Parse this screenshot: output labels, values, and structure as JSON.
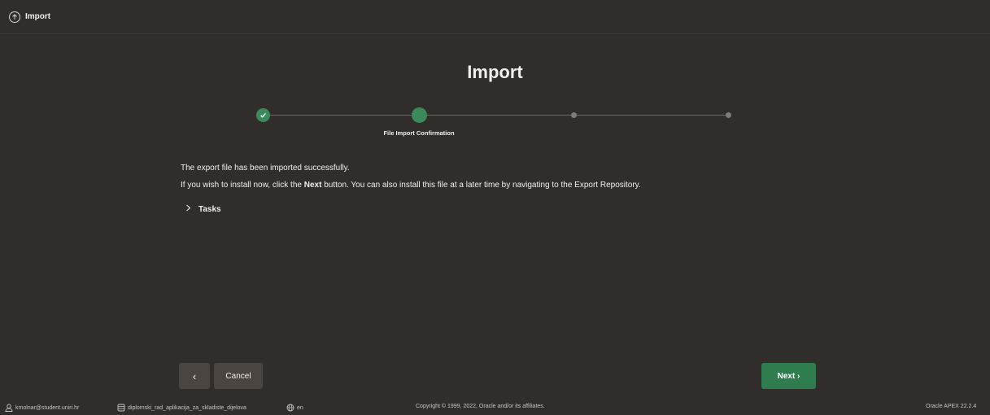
{
  "header": {
    "title": "Import",
    "icon": "upload-arrow-icon"
  },
  "page": {
    "title": "Import"
  },
  "wizard": {
    "steps": [
      {
        "label": "",
        "status": "complete"
      },
      {
        "label": "File Import Confirmation",
        "status": "current"
      },
      {
        "label": "",
        "status": "pending"
      },
      {
        "label": "",
        "status": "pending"
      }
    ]
  },
  "message": {
    "line1": "The export file has been imported successfully.",
    "line2_prefix": "If you wish to install now, click the ",
    "line2_bold": "Next",
    "line2_suffix": " button. You can also install this file at a later time by navigating to the Export Repository."
  },
  "tasks": {
    "label": "Tasks",
    "expanded": false
  },
  "buttons": {
    "back": "‹",
    "cancel": "Cancel",
    "next": "Next ›"
  },
  "footer": {
    "user": "kmolnar@student.uniri.hr",
    "workspace": "diplomski_rad_aplikacija_za_skladiste_dijelova",
    "language": "en",
    "copyright": "Copyright © 1999, 2022, Oracle and/or its affiliates.",
    "version": "Oracle APEX 22.2.4"
  },
  "colors": {
    "background": "#312d2a",
    "accent": "#3a8a5c",
    "next_button": "#2f7d4e"
  }
}
